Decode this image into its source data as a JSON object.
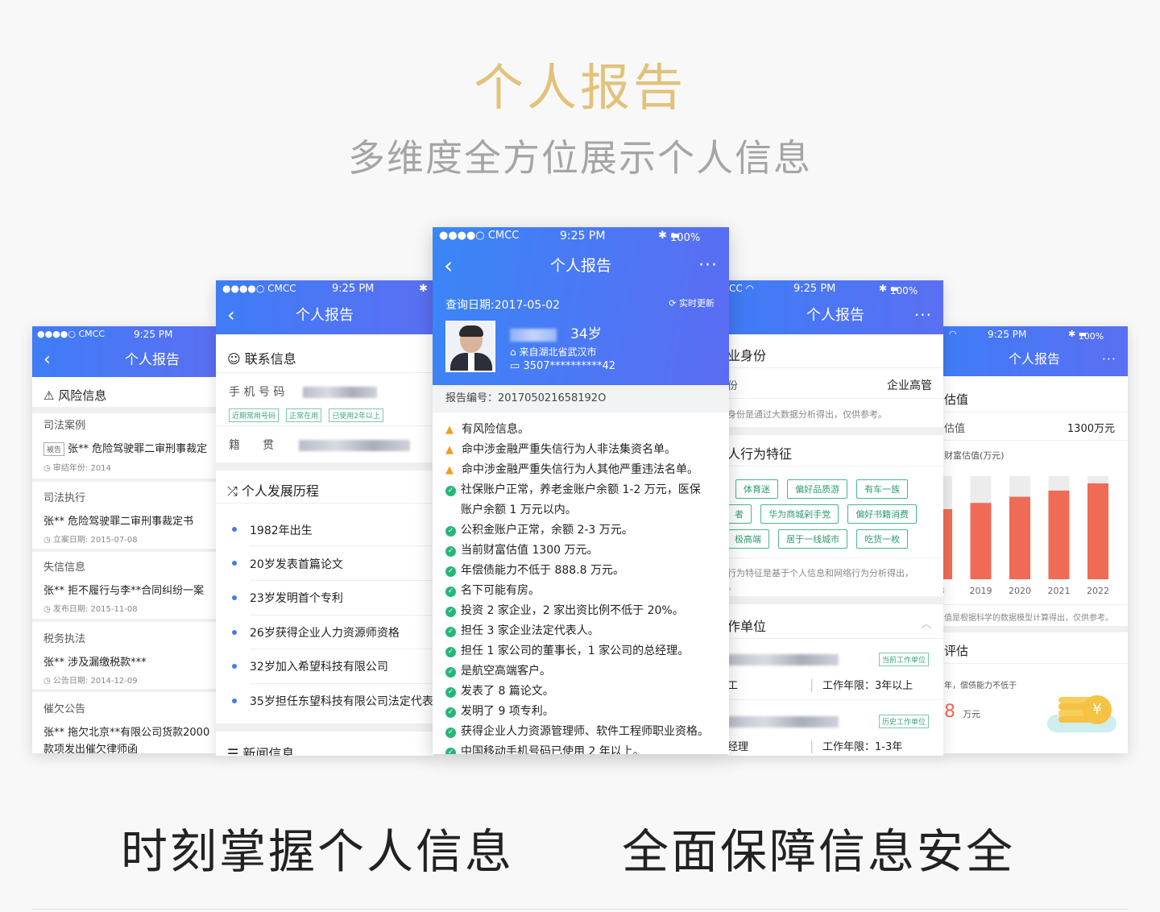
{
  "hero": {
    "title": "个人报告",
    "subtitle": "多维度全方位展示个人信息"
  },
  "bottom": {
    "left": "时刻掌握个人信息",
    "right": "全面保障信息安全"
  },
  "status": {
    "carrier": "●●●●○ CMCC",
    "time": "9:25 PM",
    "battery": "100%"
  },
  "nav_title": "个人报告",
  "p1": {
    "section": "风险信息",
    "items": [
      {
        "title": "司法案例",
        "text": "张** 危险驾驶罪二审刑事裁定",
        "badge": "被告",
        "meta": "审结年份: 2014"
      },
      {
        "title": "司法执行",
        "text": "张** 危险驾驶罪二审刑事裁定书",
        "meta": "立案日期: 2015-07-08"
      },
      {
        "title": "失信信息",
        "text": "张** 拒不履行与李**合同纠纷一案",
        "meta": "发布日期: 2015-11-08"
      },
      {
        "title": "税务执法",
        "text": "张** 涉及漏缴税款***",
        "meta": "公告日期: 2014-12-09"
      },
      {
        "title": "催欠公告",
        "text": "张** 拖欠北京**有限公司货款2000",
        "text2": "款项发出催欠律师函"
      }
    ]
  },
  "p2": {
    "contact_h": "联系信息",
    "phone_label": "手 机 号 码",
    "tags": [
      "近期常用号码",
      "正常在用",
      "已使用2年以上"
    ],
    "native_label": "籍　　贯",
    "dev_h": "个人发展历程",
    "timeline": [
      "1982年出生",
      "20岁发表首篇论文",
      "23岁发明首个专利",
      "26岁获得企业人力资源师资格",
      "32岁加入希望科技有限公司",
      "35岁担任东望科技有限公司法定代表"
    ],
    "news_h": "新闻信息"
  },
  "p3": {
    "query_date": "查询日期:2017-05-02",
    "refresh": "实时更新",
    "age": "34岁",
    "from": "来自湖北省武汉市",
    "id": "3507**********42",
    "report_no": "报告编号：201705021658192O",
    "risks": [
      {
        "type": "warn",
        "text": "有风险信息。"
      },
      {
        "type": "warn",
        "text": "命中涉金融严重失信行为人非法集资名单。"
      },
      {
        "type": "warn",
        "text": "命中涉金融严重失信行为人其他严重违法名单。"
      },
      {
        "type": "ok",
        "text": "社保账户正常，养老金账户余额 1-2 万元，医保"
      },
      {
        "type": "cont",
        "text": "账户余额 1 万元以内。"
      },
      {
        "type": "ok",
        "text": "公积金账户正常，余额 2-3 万元。"
      },
      {
        "type": "ok",
        "text": "当前财富估值 1300 万元。"
      },
      {
        "type": "ok",
        "text": "年偿债能力不低于 888.8 万元。"
      },
      {
        "type": "ok",
        "text": "名下可能有房。"
      },
      {
        "type": "ok",
        "text": "投资 2 家企业，2 家出资比例不低于 20%。"
      },
      {
        "type": "ok",
        "text": "担任 3 家企业法定代表人。"
      },
      {
        "type": "ok",
        "text": "担任 1 家公司的董事长，1 家公司的总经理。"
      },
      {
        "type": "ok",
        "text": "是航空高端客户。"
      },
      {
        "type": "ok",
        "text": "发表了 8 篇论文。"
      },
      {
        "type": "ok",
        "text": "发明了 9 项专利。"
      },
      {
        "type": "ok",
        "text": "获得企业人力资源管理师、软件工程师职业资格。"
      },
      {
        "type": "ok",
        "text": "中国移动手机号码已使用 2 年以上。"
      }
    ]
  },
  "p4": {
    "id_h": "业身份",
    "id_left": "份",
    "id_value": "企业高管",
    "id_note": "身份是通过大数据分析得出，仅供参考。",
    "beh_h": "人行为特征",
    "tag_rows": [
      [
        "体育迷",
        "偏好品质游",
        "有车一族"
      ],
      [
        "者",
        "华为商城剁手党",
        "偏好书籍消费"
      ],
      [
        "极高端",
        "居于一线城市",
        "吃货一枚"
      ]
    ],
    "beh_note": "行为特征是基于个人信息和网络行为分析得出，",
    "beh_note2": "。",
    "work_h": "作单位",
    "work_tag1": "当前工作单位",
    "work_role1": "工",
    "work_years1": "工作年限：3年以上",
    "work_tag2": "历史工作单位",
    "work_role2": "经理",
    "work_years2": "工作年限：1-3年"
  },
  "p5": {
    "section1": "估值",
    "label1": "估值",
    "value1": "1300万元",
    "chart_title": "财富估值(万元)",
    "note": "值是根据科学的数据模型计算得出，仅供参考。",
    "section2": "评估",
    "label2": "年，偿债能力不低于",
    "big_num": "8",
    "unit": "万元"
  },
  "chart_data": {
    "type": "bar",
    "title": "财富估值(万元)",
    "categories": [
      "8",
      "2019",
      "2020",
      "2021",
      "2022"
    ],
    "values": [
      0.68,
      0.74,
      0.8,
      0.86,
      0.93
    ],
    "ylim": [
      0,
      1
    ],
    "colors": {
      "bar": "#ef6b55",
      "track": "#ececec"
    }
  }
}
